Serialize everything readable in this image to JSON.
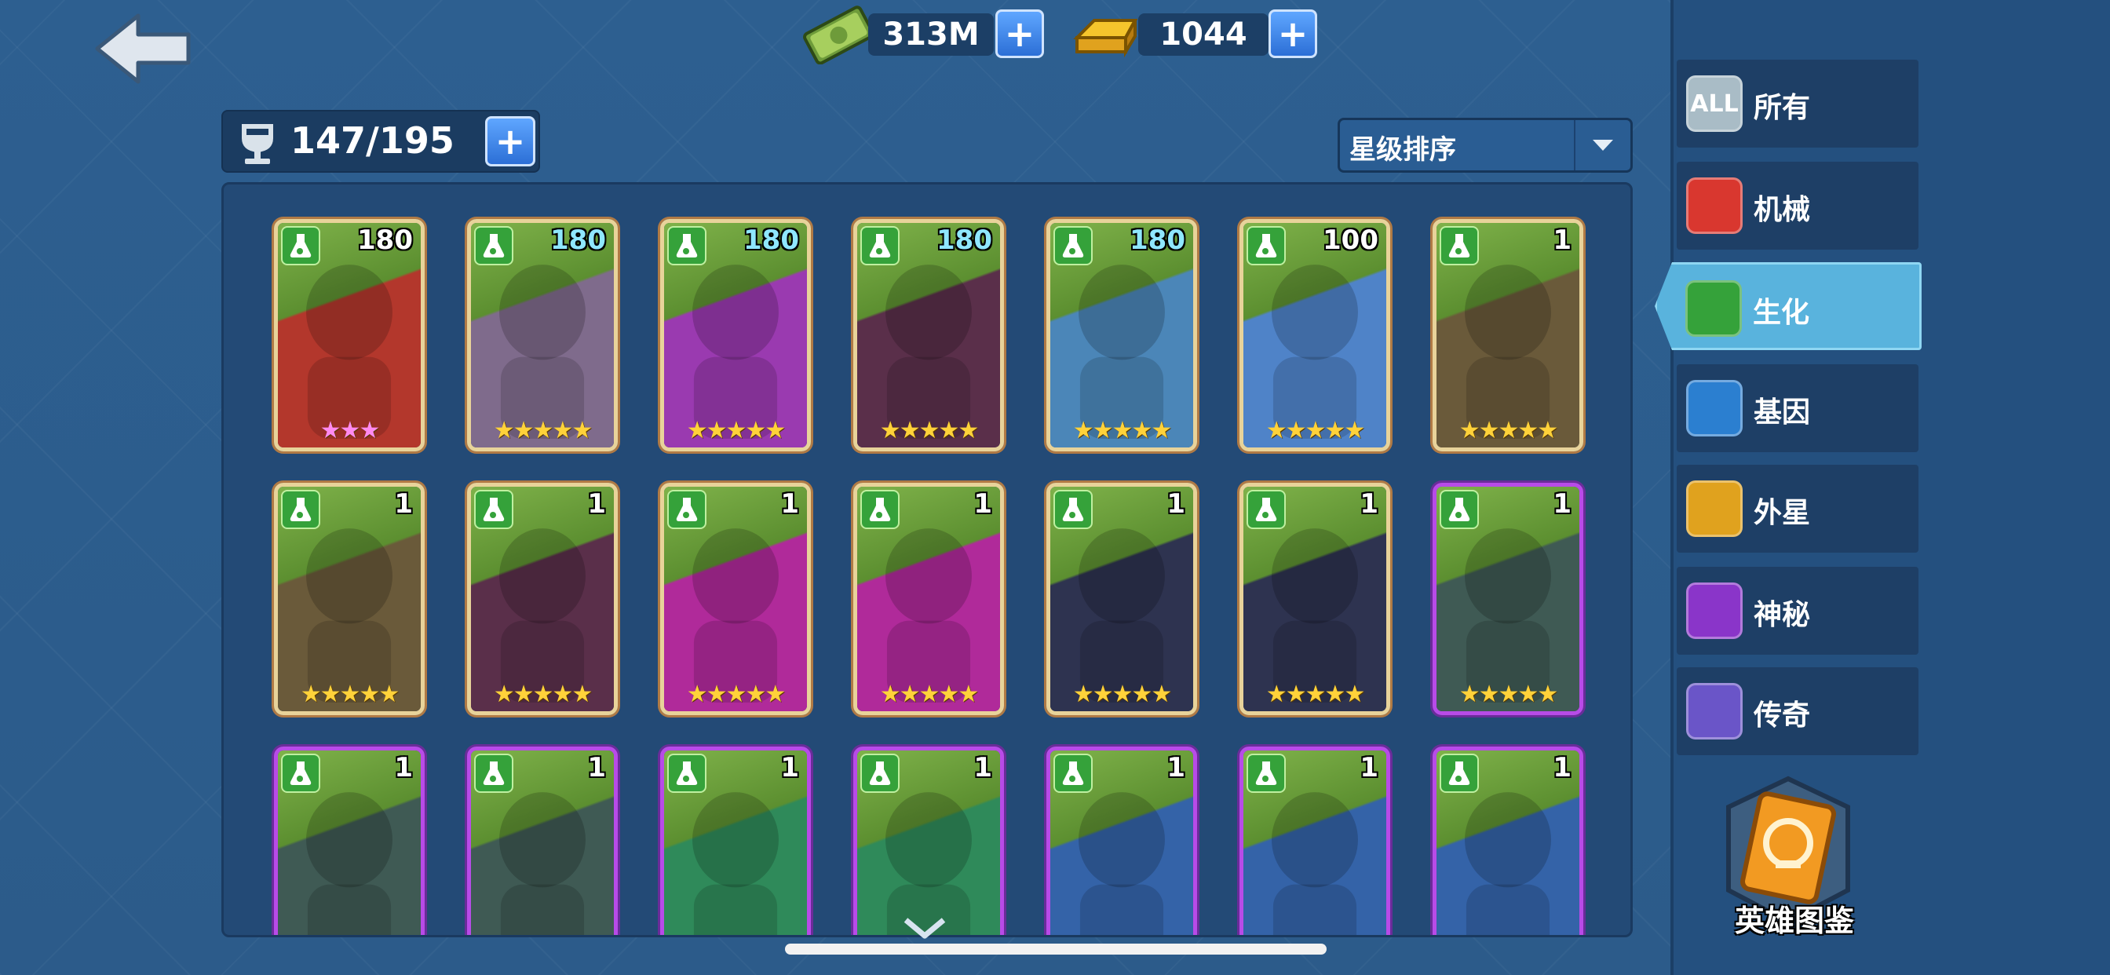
{
  "currency": {
    "money": "313M",
    "gold": "1044"
  },
  "capacity": "147/195",
  "sort": {
    "selected": "星级排序"
  },
  "categories": [
    {
      "label": "所有",
      "icon": "all-icon",
      "badge": "ALL",
      "color": "#a9bcc6"
    },
    {
      "label": "机械",
      "icon": "mechanical-icon",
      "color": "#d9372f"
    },
    {
      "label": "生化",
      "icon": "biochem-flask-icon",
      "color": "#35a23a"
    },
    {
      "label": "基因",
      "icon": "gene-dna-icon",
      "color": "#2b7fd0"
    },
    {
      "label": "外星",
      "icon": "alien-icon",
      "color": "#e0a21e"
    },
    {
      "label": "神秘",
      "icon": "mystery-icon",
      "color": "#8a35c9"
    },
    {
      "label": "传奇",
      "icon": "legend-icon",
      "color": "#6a55c8"
    }
  ],
  "selected_category": "生化",
  "codex_label": "英雄图鉴",
  "heroes": [
    {
      "level": "180",
      "stars": 3,
      "star_color": "pink",
      "frame": "gold",
      "art": "#b3372c",
      "levelColor": "#ffffff"
    },
    {
      "level": "180",
      "stars": 5,
      "star_color": "gold",
      "frame": "gold",
      "art": "#7f6b8c",
      "levelColor": "#8fe7ff"
    },
    {
      "level": "180",
      "stars": 5,
      "star_color": "gold",
      "frame": "gold",
      "art": "#9a3ab0",
      "levelColor": "#8fe7ff"
    },
    {
      "level": "180",
      "stars": 5,
      "star_color": "gold",
      "frame": "gold",
      "art": "#5a2f4a",
      "levelColor": "#8fe7ff"
    },
    {
      "level": "180",
      "stars": 5,
      "star_color": "gold",
      "frame": "gold",
      "art": "#4b86b8",
      "levelColor": "#8fe7ff"
    },
    {
      "level": "100",
      "stars": 5,
      "star_color": "gold",
      "frame": "gold",
      "art": "#4f83c8",
      "levelColor": "#ffffff"
    },
    {
      "level": "1",
      "stars": 5,
      "star_color": "gold",
      "frame": "gold",
      "art": "#6a5a3a",
      "levelColor": "#ffffff"
    },
    {
      "level": "1",
      "stars": 5,
      "star_color": "gold",
      "frame": "gold",
      "art": "#6a5a3a",
      "levelColor": "#ffffff"
    },
    {
      "level": "1",
      "stars": 5,
      "star_color": "gold",
      "frame": "gold",
      "art": "#5a2f4a",
      "levelColor": "#ffffff"
    },
    {
      "level": "1",
      "stars": 5,
      "star_color": "gold",
      "frame": "gold",
      "art": "#b02a9a",
      "levelColor": "#ffffff"
    },
    {
      "level": "1",
      "stars": 5,
      "star_color": "gold",
      "frame": "gold",
      "art": "#b02a9a",
      "levelColor": "#ffffff"
    },
    {
      "level": "1",
      "stars": 5,
      "star_color": "gold",
      "frame": "gold",
      "art": "#2e3350",
      "levelColor": "#ffffff"
    },
    {
      "level": "1",
      "stars": 5,
      "star_color": "gold",
      "frame": "gold",
      "art": "#2e3350",
      "levelColor": "#ffffff"
    },
    {
      "level": "1",
      "stars": 5,
      "star_color": "gold",
      "frame": "purple",
      "art": "#3f5a54",
      "levelColor": "#ffffff"
    },
    {
      "level": "1",
      "stars": 0,
      "star_color": "gold",
      "frame": "purple",
      "art": "#3f5a54",
      "levelColor": "#ffffff"
    },
    {
      "level": "1",
      "stars": 0,
      "star_color": "gold",
      "frame": "purple",
      "art": "#3f5a54",
      "levelColor": "#ffffff"
    },
    {
      "level": "1",
      "stars": 0,
      "star_color": "gold",
      "frame": "purple",
      "art": "#2f8a5a",
      "levelColor": "#ffffff"
    },
    {
      "level": "1",
      "stars": 0,
      "star_color": "gold",
      "frame": "purple",
      "art": "#2f8a5a",
      "levelColor": "#ffffff"
    },
    {
      "level": "1",
      "stars": 0,
      "star_color": "gold",
      "frame": "purple",
      "art": "#3463a8",
      "levelColor": "#ffffff"
    },
    {
      "level": "1",
      "stars": 0,
      "star_color": "gold",
      "frame": "purple",
      "art": "#3463a8",
      "levelColor": "#ffffff"
    },
    {
      "level": "1",
      "stars": 0,
      "star_color": "gold",
      "frame": "purple",
      "art": "#3463a8",
      "levelColor": "#ffffff"
    }
  ]
}
